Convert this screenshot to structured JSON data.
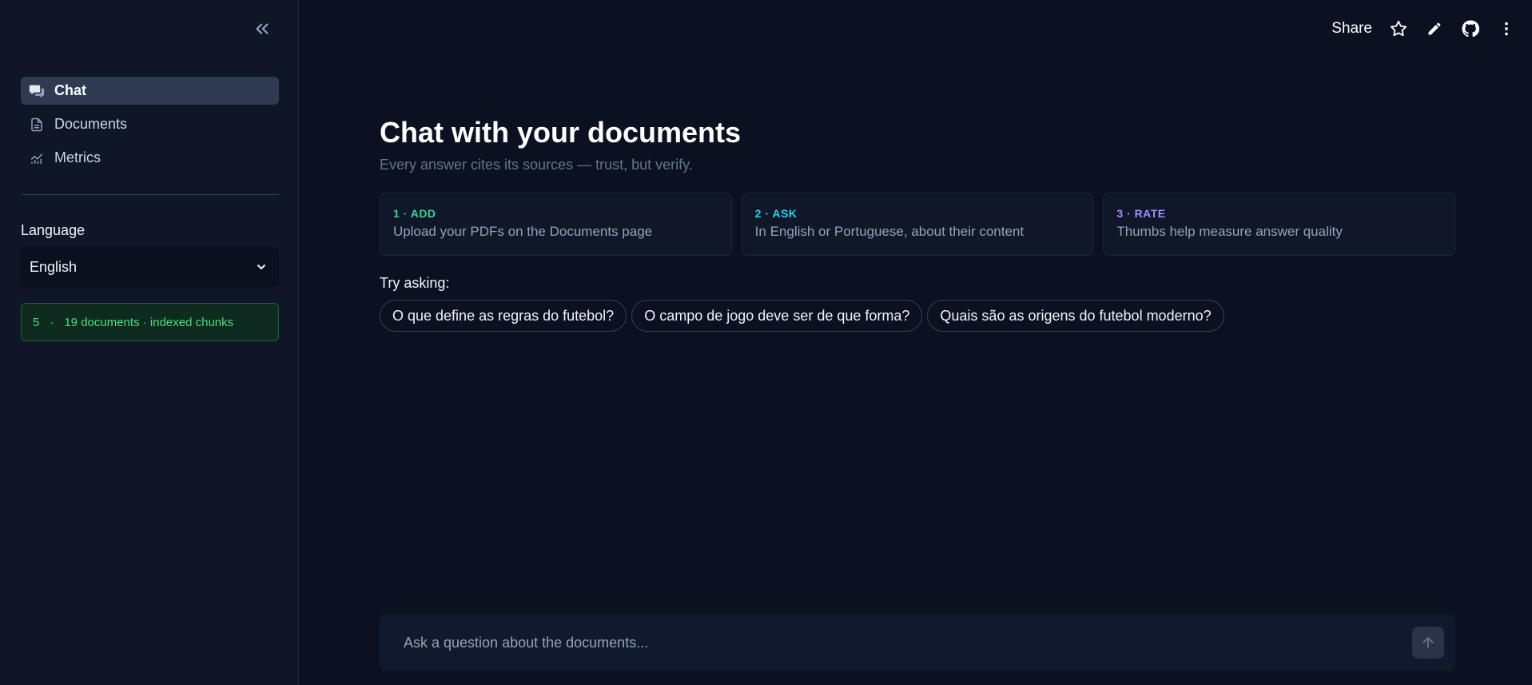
{
  "sidebar": {
    "nav": [
      {
        "label": "Chat",
        "icon": "chat-bubbles-icon",
        "active": true
      },
      {
        "label": "Documents",
        "icon": "document-icon",
        "active": false
      },
      {
        "label": "Metrics",
        "icon": "chart-icon",
        "active": false
      }
    ],
    "language_label": "Language",
    "language_value": "English",
    "status": {
      "count": "5",
      "separator": "·",
      "text": "19 documents · indexed chunks"
    }
  },
  "topbar": {
    "share_label": "Share"
  },
  "main": {
    "title": "Chat with your documents",
    "subtitle": "Every answer cites its sources — trust, but verify.",
    "steps": [
      {
        "tag": "1 · ADD",
        "desc": "Upload your PDFs on the Documents page",
        "color": "#34d399"
      },
      {
        "tag": "2 · ASK",
        "desc": "In English or Portuguese, about their content",
        "color": "#22d3ee"
      },
      {
        "tag": "3 · RATE",
        "desc": "Thumbs help measure answer quality",
        "color": "#a78bfa"
      }
    ],
    "try_label": "Try asking:",
    "suggestions": [
      "O que define as regras do futebol?",
      "O campo de jogo deve ser de que forma?",
      "Quais são as origens do futebol moderno?"
    ],
    "input_placeholder": "Ask a question about the documents..."
  }
}
